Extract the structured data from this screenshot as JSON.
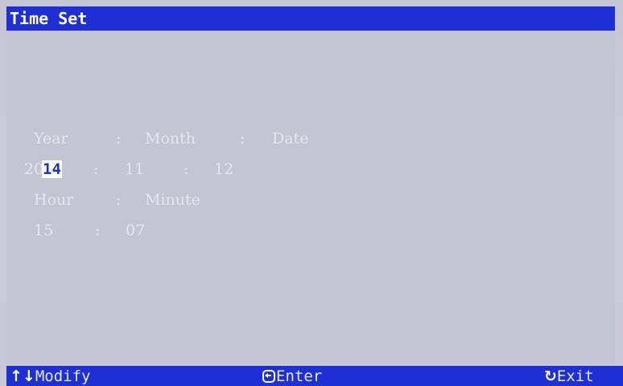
{
  "title": "Time Set",
  "fields": {
    "row1": {
      "year": "Year",
      "sep1": ":",
      "month": "Month",
      "sep2": ":",
      "date": "Date"
    },
    "row2": {
      "year_prefix": "20",
      "year_selected": "14",
      "sep1": ":",
      "month": "11",
      "sep2": ":",
      "date": "12"
    },
    "row3": {
      "hour": "Hour",
      "sep": ":",
      "minute": "Minute"
    },
    "row4": {
      "hour": "15",
      "sep": ":",
      "minute": "07"
    }
  },
  "footer": {
    "modify_icon": "↑↓",
    "modify": "Modify",
    "enter": "Enter",
    "exit_icon": "↻",
    "exit": "Exit"
  },
  "colors": {
    "bar": "#1f2fd6",
    "background": "#c5c4d3",
    "text": "#e6e5ef",
    "selection": "#ffffff"
  },
  "icons": [
    "up-down-arrow-icon",
    "enter-icon",
    "refresh-icon"
  ]
}
